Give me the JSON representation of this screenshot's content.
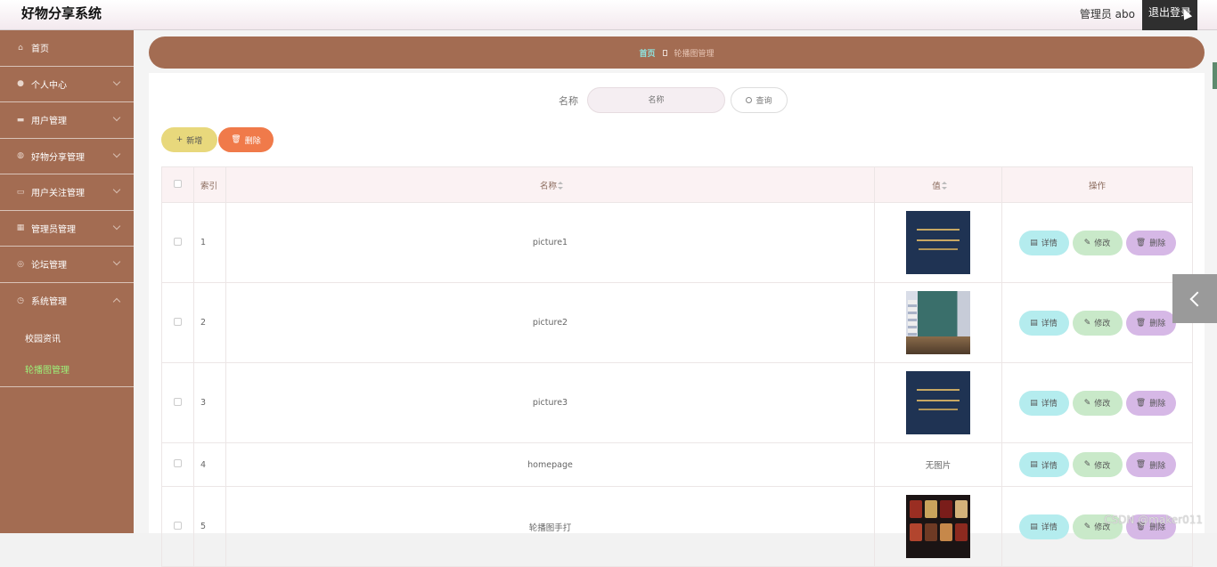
{
  "header": {
    "app_title": "好物分享系统",
    "admin_label": "管理员 abo",
    "logout_label": "退出登录"
  },
  "sidebar": {
    "items": [
      {
        "label": "首页",
        "icon": "home-icon"
      },
      {
        "label": "个人中心",
        "icon": "user-icon"
      },
      {
        "label": "用户管理",
        "icon": "users-icon"
      },
      {
        "label": "好物分享管理",
        "icon": "globe-icon"
      },
      {
        "label": "用户关注管理",
        "icon": "monitor-icon"
      },
      {
        "label": "管理员管理",
        "icon": "grid-icon"
      },
      {
        "label": "论坛管理",
        "icon": "compass-icon"
      },
      {
        "label": "系统管理",
        "icon": "clock-icon"
      }
    ],
    "subitems": [
      {
        "label": "校园资讯"
      },
      {
        "label": "轮播图管理"
      }
    ]
  },
  "breadcrumb": {
    "home": "首页",
    "current": "轮播图管理"
  },
  "search": {
    "label": "名称",
    "placeholder": "名称",
    "button": "查询"
  },
  "actions": {
    "add": "新增",
    "delete": "删除"
  },
  "table": {
    "headers": {
      "index": "索引",
      "name": "名称",
      "value": "值",
      "ops": "操作"
    },
    "rows": [
      {
        "index": "1",
        "name": "picture1",
        "image": "navy-book"
      },
      {
        "index": "2",
        "name": "picture2",
        "image": "room"
      },
      {
        "index": "3",
        "name": "picture3",
        "image": "navy-book"
      },
      {
        "index": "4",
        "name": "homepage",
        "value_text": "无图片"
      },
      {
        "index": "5",
        "name": "轮播图手打",
        "image": "food"
      }
    ],
    "op_labels": {
      "detail": "详情",
      "edit": "修改",
      "delete": "删除"
    }
  },
  "watermark": "CSDN @maker011",
  "colors": {
    "sidebar_bg": "#a36c52",
    "active_sub": "#9cf27a",
    "add_btn": "#e8d87c",
    "delete_btn": "#f07a4a"
  }
}
